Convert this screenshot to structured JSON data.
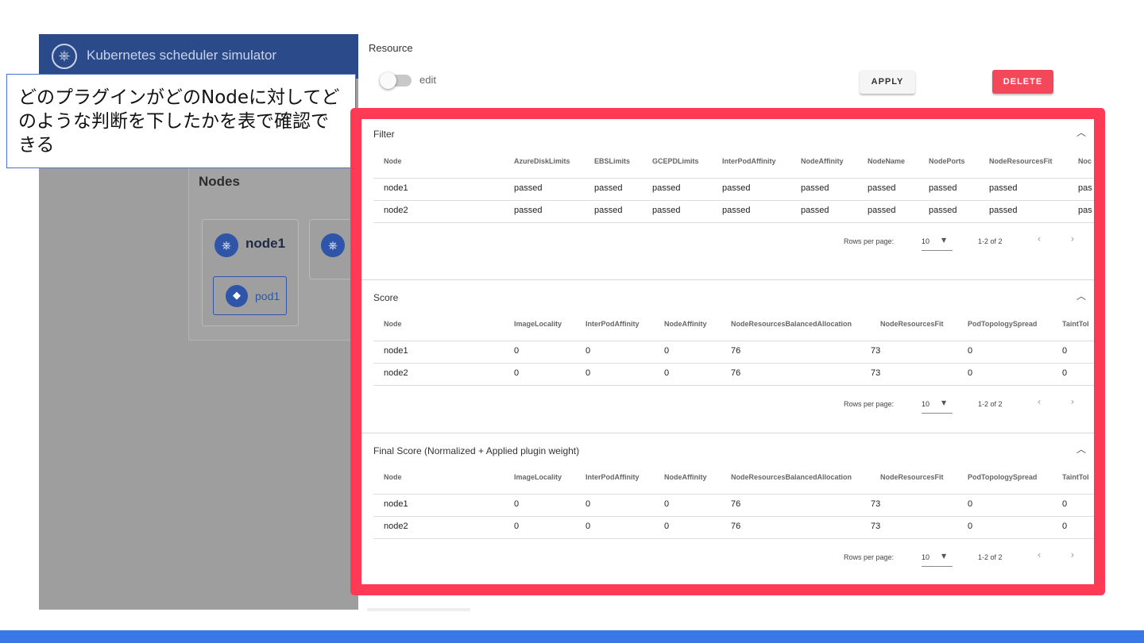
{
  "background_app": {
    "app_title": "Kubernetes scheduler simulator",
    "nodes_title": "Nodes",
    "node1_label": "node1",
    "pod1_label": "pod1",
    "logo_glyph": "⎈"
  },
  "callout": {
    "text": "どのプラグインがどのNodeに対してどのような判断を下したかを表で確認できる"
  },
  "resource": {
    "title": "Resource",
    "edit_label": "edit",
    "apply_label": "APPLY",
    "delete_label": "DELETE"
  },
  "colors": {
    "highlight": "#ff3a55",
    "appbar": "#2b4a8a",
    "delete": "#f24859",
    "slide_bar": "#3b78e7"
  },
  "filter": {
    "title": "Filter",
    "columns": [
      "Node",
      "AzureDiskLimits",
      "EBSLimits",
      "GCEPDLimits",
      "InterPodAffinity",
      "NodeAffinity",
      "NodeName",
      "NodePorts",
      "NodeResourcesFit",
      "Noc"
    ],
    "rows": [
      [
        "node1",
        "passed",
        "passed",
        "passed",
        "passed",
        "passed",
        "passed",
        "passed",
        "passed",
        "pas"
      ],
      [
        "node2",
        "passed",
        "passed",
        "passed",
        "passed",
        "passed",
        "passed",
        "passed",
        "passed",
        "pas"
      ]
    ],
    "rows_per_page_label": "Rows per page:",
    "rows_per_page": "10",
    "range": "1-2 of 2"
  },
  "score": {
    "title": "Score",
    "columns": [
      "Node",
      "ImageLocality",
      "InterPodAffinity",
      "NodeAffinity",
      "NodeResourcesBalancedAllocation",
      "NodeResourcesFit",
      "PodTopologySpread",
      "TaintTol"
    ],
    "rows": [
      [
        "node1",
        "0",
        "0",
        "0",
        "76",
        "73",
        "0",
        "0"
      ],
      [
        "node2",
        "0",
        "0",
        "0",
        "76",
        "73",
        "0",
        "0"
      ]
    ],
    "rows_per_page_label": "Rows per page:",
    "rows_per_page": "10",
    "range": "1-2 of 2"
  },
  "final_score": {
    "title": "Final Score (Normalized + Applied plugin weight)",
    "columns": [
      "Node",
      "ImageLocality",
      "InterPodAffinity",
      "NodeAffinity",
      "NodeResourcesBalancedAllocation",
      "NodeResourcesFit",
      "PodTopologySpread",
      "TaintTol"
    ],
    "rows": [
      [
        "node1",
        "0",
        "0",
        "0",
        "76",
        "73",
        "0",
        "0"
      ],
      [
        "node2",
        "0",
        "0",
        "0",
        "76",
        "73",
        "0",
        "0"
      ]
    ],
    "rows_per_page_label": "Rows per page:",
    "rows_per_page": "10",
    "range": "1-2 of 2"
  },
  "icons": {
    "collapse": "chevron-up-icon",
    "prev": "chevron-left-icon",
    "next": "chevron-right-icon",
    "dropdown": "caret-down-icon"
  }
}
